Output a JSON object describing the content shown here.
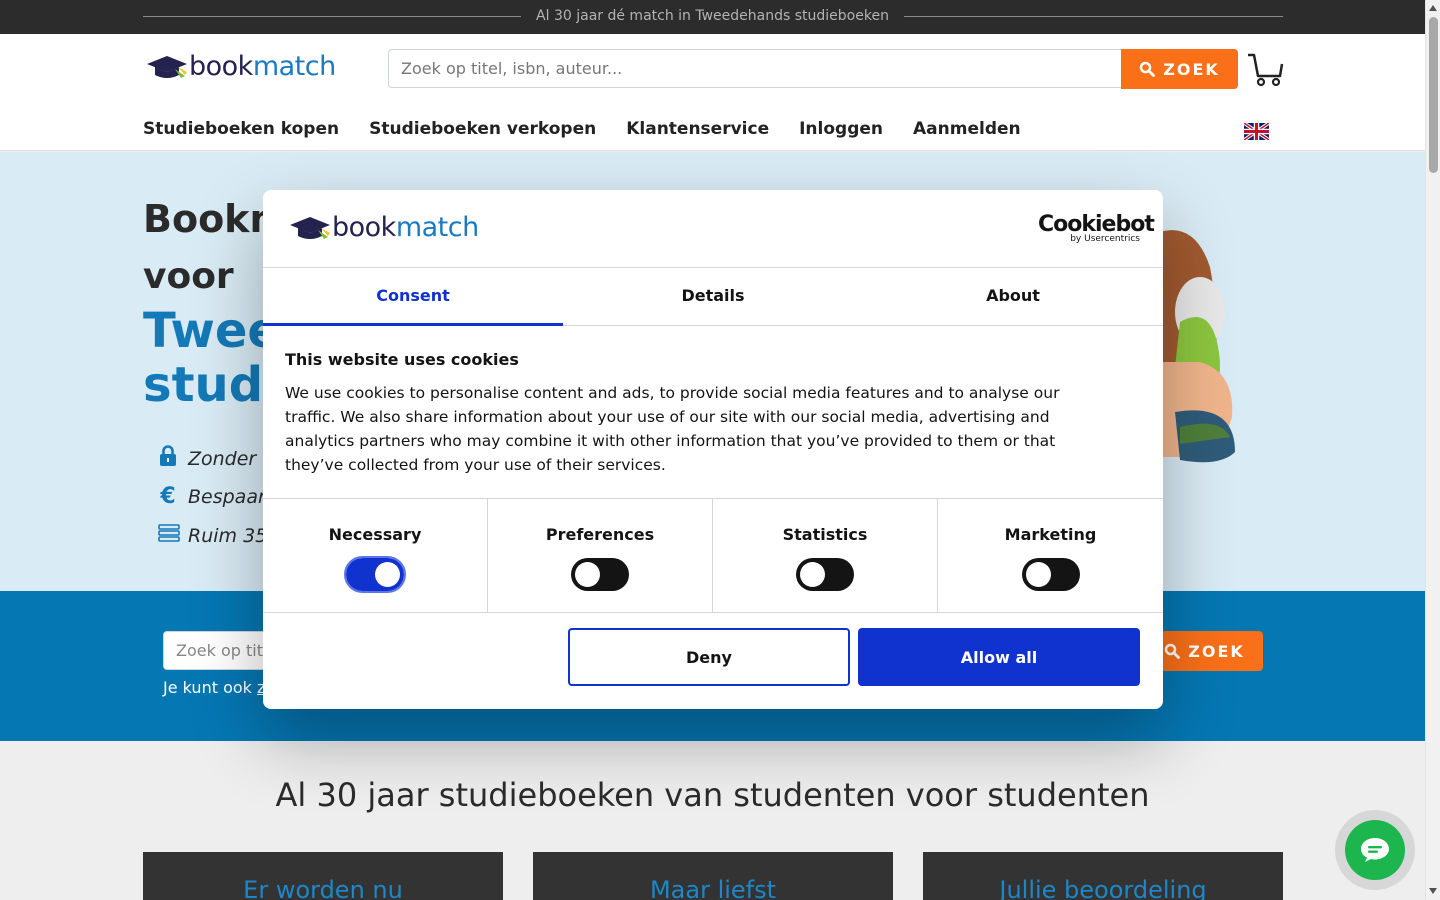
{
  "topbar": {
    "text": "Al 30 jaar dé match in Tweedehands studieboeken"
  },
  "brand": {
    "book": "book",
    "match": "match",
    "navy": "#24224e",
    "blue": "#1c7bc0",
    "orange": "#f97018"
  },
  "header": {
    "search_placeholder": "Zoek op titel, isbn, auteur...",
    "search_button": "ZOEK",
    "nav": [
      "Studieboeken kopen",
      "Studieboeken verkopen",
      "Klantenservice",
      "Inloggen",
      "Aanmelden"
    ]
  },
  "hero": {
    "line1": "Bookm",
    "line2": "voor",
    "line3": "Twee",
    "line4": "stud",
    "usps": [
      {
        "icon": "lock-icon",
        "text": "Zonder r"
      },
      {
        "icon": "euro-icon",
        "text": "Bespaar"
      },
      {
        "icon": "books-icon",
        "text": "Ruim 35"
      }
    ]
  },
  "band": {
    "search_placeholder": "Zoek op tit",
    "search_button": "ZOEK",
    "note_prefix": "Je kunt ook ",
    "note_link": "z"
  },
  "section": {
    "title": "Al 30 jaar studieboeken van studenten voor studenten",
    "cards": [
      "Er worden nu",
      "Maar liefst",
      "Jullie beoordeling"
    ]
  },
  "cookie_dialog": {
    "cookiebot": "Cookiebot",
    "cookiebot_by": "by Usercentrics",
    "tabs": [
      "Consent",
      "Details",
      "About"
    ],
    "active_tab": "Consent",
    "heading": "This website uses cookies",
    "body": "We use cookies to personalise content and ads, to provide social media features and to analyse our traffic. We also share information about your use of our site with our social media, advertising and analytics partners who may combine it with other information that you’ve provided to them or that they’ve collected from your use of their services.",
    "toggles": [
      {
        "label": "Necessary",
        "on": true
      },
      {
        "label": "Preferences",
        "on": false
      },
      {
        "label": "Statistics",
        "on": false
      },
      {
        "label": "Marketing",
        "on": false
      }
    ],
    "deny": "Deny",
    "allow_all": "Allow all",
    "accent": "#1032cf"
  }
}
